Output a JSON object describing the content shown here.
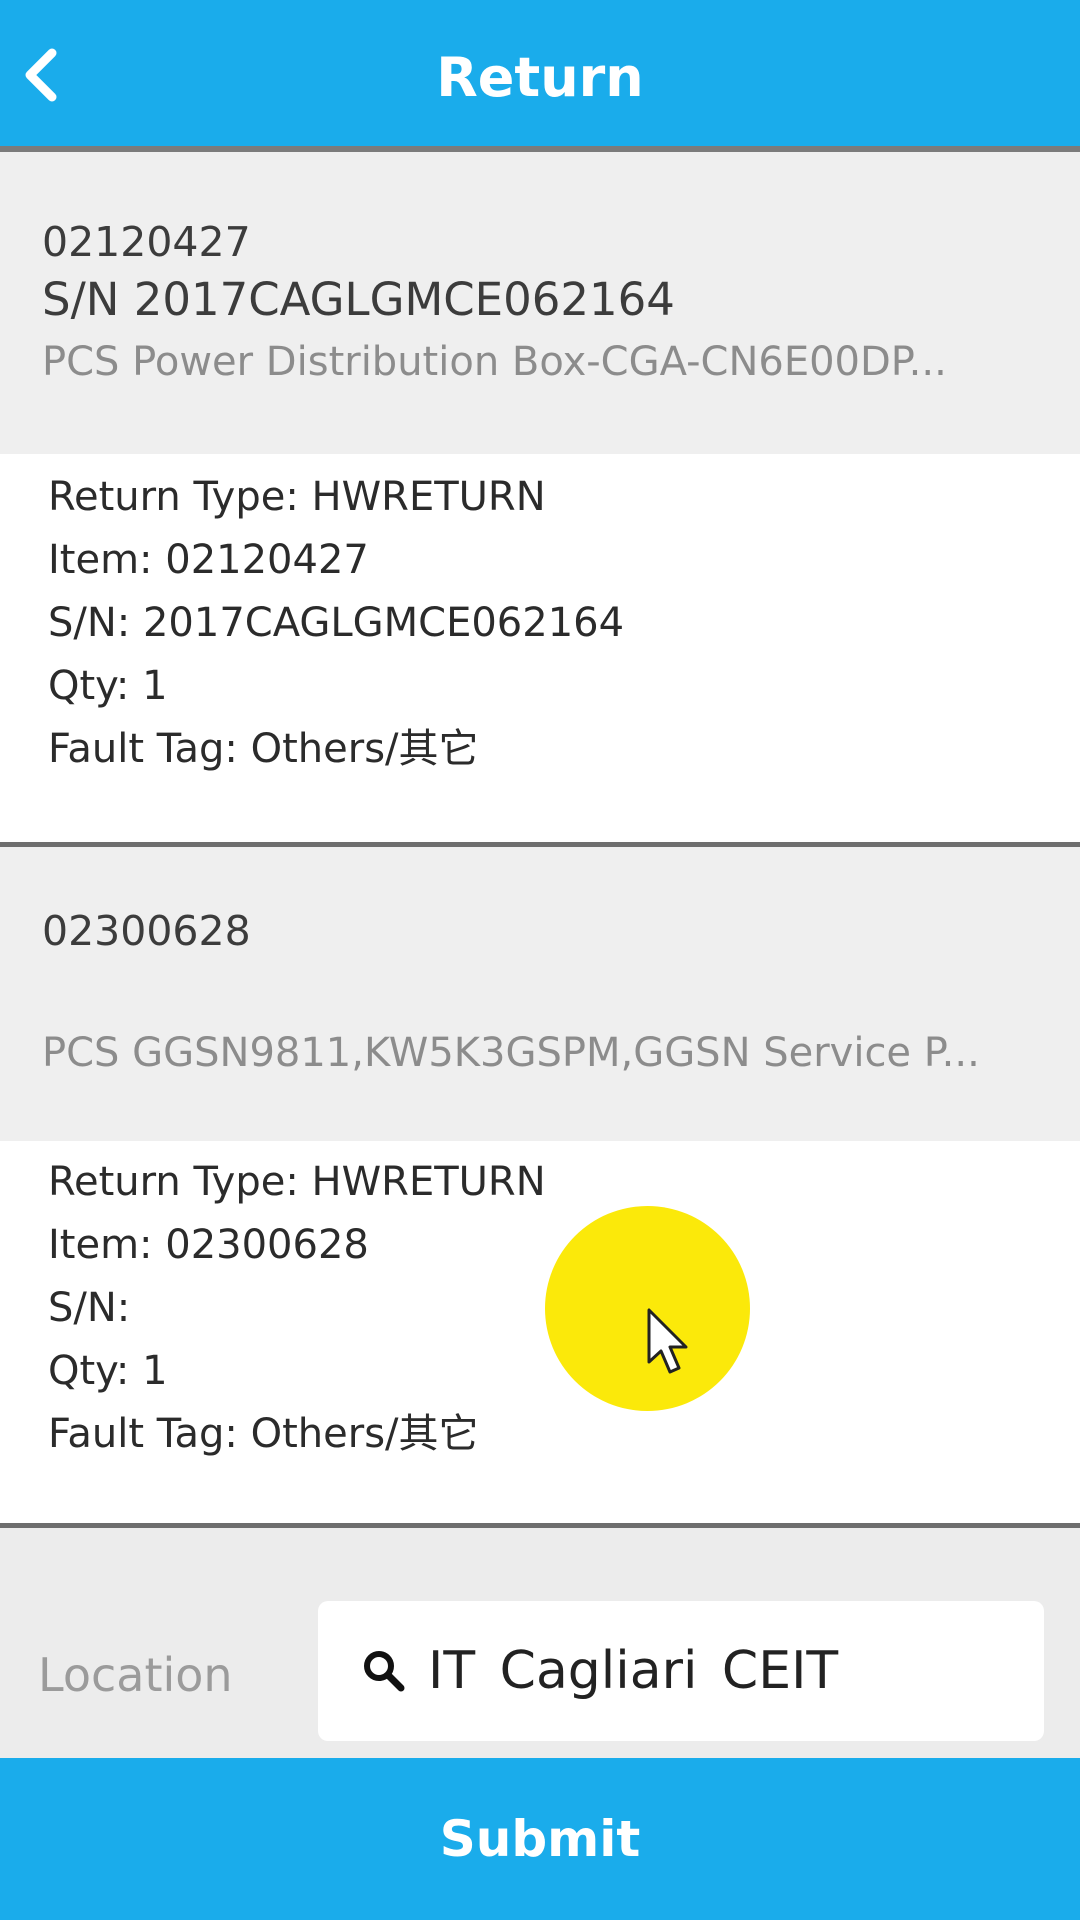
{
  "header": {
    "title": "Return",
    "back_icon": "chevron-left-icon",
    "color": "#1aaceb"
  },
  "items": [
    {
      "code": "02120427",
      "sn_line": "S/N 2017CAGLGMCE062164",
      "description": "PCS Power Distribution Box-CGA-CN6E00DP...",
      "details": {
        "return_type": "Return Type: HWRETURN",
        "item": "Item: 02120427",
        "sn": "S/N: 2017CAGLGMCE062164",
        "qty": "Qty: 1",
        "fault_tag": "Fault Tag: Others/其它"
      }
    },
    {
      "code": "02300628",
      "sn_line": "",
      "description": "PCS GGSN9811,KW5K3GSPM,GGSN Service P...",
      "details": {
        "return_type": "Return Type: HWRETURN",
        "item": "Item: 02300628",
        "sn": "S/N:",
        "qty": "Qty: 1",
        "fault_tag": "Fault Tag: Others/其它"
      }
    }
  ],
  "location": {
    "label": "Location",
    "value": "IT Cagliari CEIT",
    "icon": "search-icon"
  },
  "submit": {
    "label": "Submit",
    "color": "#1aaceb"
  },
  "cursor": {
    "highlight_color": "#fbe90a",
    "icon": "pointer-cursor-icon"
  }
}
